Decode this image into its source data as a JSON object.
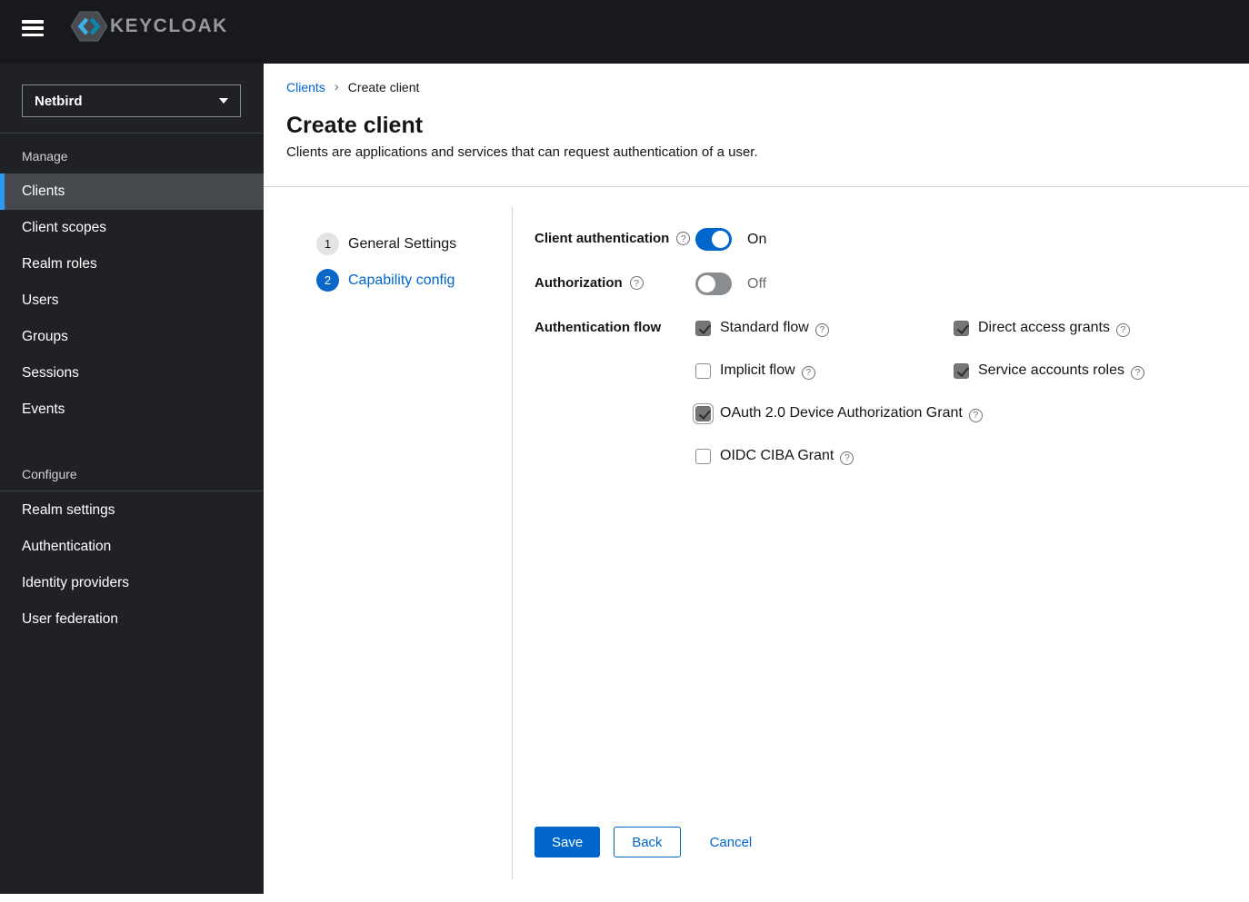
{
  "header": {
    "logo_text": "KEYCLOAK"
  },
  "sidebar": {
    "realm_selector": {
      "value": "Netbird"
    },
    "sections": [
      {
        "label": "Manage",
        "items": [
          {
            "label": "Clients",
            "selected": true
          },
          {
            "label": "Client scopes",
            "selected": false
          },
          {
            "label": "Realm roles",
            "selected": false
          },
          {
            "label": "Users",
            "selected": false
          },
          {
            "label": "Groups",
            "selected": false
          },
          {
            "label": "Sessions",
            "selected": false
          },
          {
            "label": "Events",
            "selected": false
          }
        ]
      },
      {
        "label": "Configure",
        "items": [
          {
            "label": "Realm settings",
            "selected": false
          },
          {
            "label": "Authentication",
            "selected": false
          },
          {
            "label": "Identity providers",
            "selected": false
          },
          {
            "label": "User federation",
            "selected": false
          }
        ]
      }
    ]
  },
  "breadcrumb": {
    "items": [
      {
        "label": "Clients",
        "is_link": true
      },
      {
        "label": "Create client",
        "is_link": false
      }
    ]
  },
  "page": {
    "title": "Create client",
    "subtitle": "Clients are applications and services that can request authentication of a user."
  },
  "wizard": {
    "steps": [
      {
        "number": "1",
        "label": "General Settings",
        "active": false
      },
      {
        "number": "2",
        "label": "Capability config",
        "active": true
      }
    ]
  },
  "form": {
    "client_authentication": {
      "label": "Client authentication",
      "state_label": "On",
      "enabled": true
    },
    "authorization": {
      "label": "Authorization",
      "state_label": "Off",
      "enabled": false
    },
    "authentication_flow": {
      "label": "Authentication flow",
      "options": [
        {
          "label": "Standard flow",
          "checked": true,
          "focused": false
        },
        {
          "label": "Direct access grants",
          "checked": true,
          "focused": false
        },
        {
          "label": "Implicit flow",
          "checked": false,
          "focused": false
        },
        {
          "label": "Service accounts roles",
          "checked": true,
          "focused": false
        },
        {
          "label": "OAuth 2.0 Device Authorization Grant",
          "checked": true,
          "focused": true
        },
        {
          "label": "OIDC CIBA Grant",
          "checked": false,
          "focused": false
        }
      ]
    }
  },
  "actions": {
    "save": "Save",
    "back": "Back",
    "cancel": "Cancel"
  },
  "icons": {
    "hamburger": "menu-icon",
    "realm_caret": "chevron-down-icon",
    "breadcrumb_separator": "angle-right-icon",
    "help": "question-circle-icon",
    "logo": "keycloak-hexagon-logo"
  },
  "colors": {
    "primary_blue": "#0066cc",
    "nav_accent_blue": "#2b9af3",
    "header_bg": "#17191c",
    "sidebar_bg": "#1f2124",
    "selected_nav_bg": "#45494e",
    "checked_checkbox_gray": "#767676",
    "toggle_off_gray": "#8a8d90",
    "divider_gray": "#d2d2d2"
  }
}
